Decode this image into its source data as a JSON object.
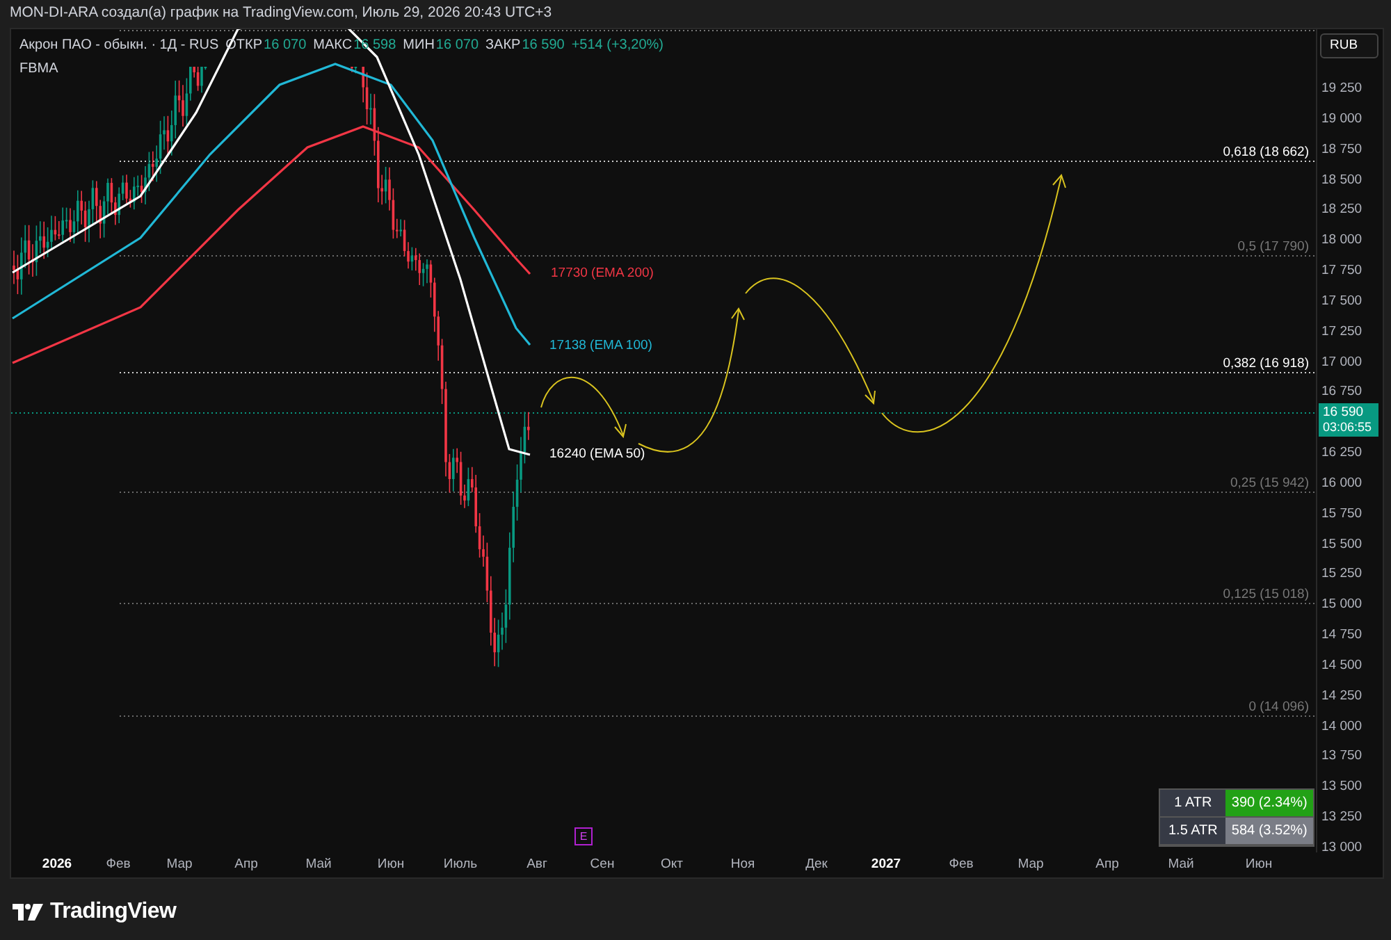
{
  "header": "MON-DI-ARA создал(а) график на TradingView.com, Июль 29, 2026 20:43 UTC+3",
  "legend": {
    "symbol": "Акрон ПАО - обыкн. · 1Д - RUS",
    "fields": [
      {
        "label": "ОТКР",
        "value": "16 070"
      },
      {
        "label": "МАКС",
        "value": "16 598"
      },
      {
        "label": "МИН",
        "value": "16 070"
      },
      {
        "label": "ЗАКР",
        "value": "16 590"
      }
    ],
    "change": "+514 (+3,20%)",
    "indicator": "FBMA"
  },
  "currency": "RUB",
  "price_axis": [
    "19 250",
    "19 000",
    "18 750",
    "18 500",
    "18 250",
    "18 000",
    "17 750",
    "17 500",
    "17 250",
    "17 000",
    "16 750",
    "16 250",
    "16 000",
    "15 750",
    "15 500",
    "15 250",
    "15 000",
    "14 750",
    "14 500",
    "14 250",
    "14 000",
    "13 750",
    "13 500",
    "13 250",
    "13 000"
  ],
  "fib_levels": [
    {
      "label": "0,618 (18 662)",
      "emphasis": true
    },
    {
      "label": "0,5 (17 790)",
      "emphasis": false
    },
    {
      "label": "0,382 (16 918)",
      "emphasis": true
    },
    {
      "label": "0,25 (15 942)",
      "emphasis": false
    },
    {
      "label": "0,125 (15 018)",
      "emphasis": false
    },
    {
      "label": "0 (14 096)",
      "emphasis": false
    }
  ],
  "emas": [
    {
      "label": "17730 (EMA 200)",
      "color": "#f23645"
    },
    {
      "label": "17138 (EMA 100)",
      "color": "#21b8d6"
    },
    {
      "label": "16240 (EMA 50)",
      "color": "#ffffff"
    }
  ],
  "price_badge": {
    "price": "16 590",
    "countdown": "03:06:55"
  },
  "event_marker": "E",
  "atr": [
    {
      "label": "1 ATR",
      "value": "390 (2.34%)",
      "color": "#22a116"
    },
    {
      "label": "1.5 ATR",
      "value": "584 (3.52%)",
      "color": "#7a7d86"
    }
  ],
  "time_axis": [
    {
      "label": "2026",
      "kind": "year"
    },
    {
      "label": "Фев",
      "kind": "month"
    },
    {
      "label": "Мар",
      "kind": "month"
    },
    {
      "label": "Апр",
      "kind": "month"
    },
    {
      "label": "Май",
      "kind": "month"
    },
    {
      "label": "Июн",
      "kind": "month"
    },
    {
      "label": "Июль",
      "kind": "month"
    },
    {
      "label": "Авг",
      "kind": "month"
    },
    {
      "label": "Сен",
      "kind": "month"
    },
    {
      "label": "Окт",
      "kind": "month"
    },
    {
      "label": "Ноя",
      "kind": "month"
    },
    {
      "label": "Дек",
      "kind": "month"
    },
    {
      "label": "2027",
      "kind": "year"
    },
    {
      "label": "Фев",
      "kind": "month"
    },
    {
      "label": "Мар",
      "kind": "month"
    },
    {
      "label": "Апр",
      "kind": "month"
    },
    {
      "label": "Май",
      "kind": "month"
    },
    {
      "label": "Июн",
      "kind": "month"
    }
  ],
  "footer_logo": "TradingView"
}
